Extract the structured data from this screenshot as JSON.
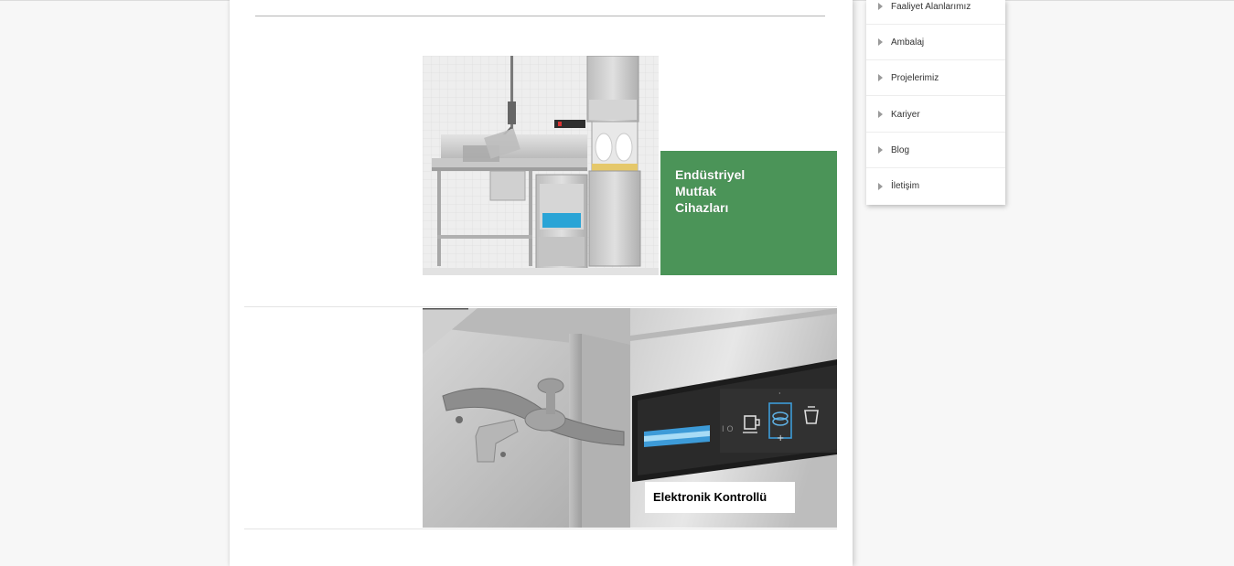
{
  "content": {
    "banner1": {
      "lines": [
        "Endüstriyel",
        "Mutfak",
        "Cihazları"
      ],
      "accent_color": "#4b9458"
    },
    "banner2": {
      "caption": "Elektronik Kontrollü",
      "panel_icons": [
        "cup-icon",
        "plates-icon",
        "pot-icon"
      ]
    }
  },
  "sidebar": {
    "items": [
      {
        "label": "Faaliyet Alanlarımız",
        "icon": "chevron-right-icon"
      },
      {
        "label": "Ambalaj",
        "icon": "chevron-right-icon"
      },
      {
        "label": "Projelerimiz",
        "icon": "chevron-right-icon"
      },
      {
        "label": "Kariyer",
        "icon": "chevron-right-icon"
      },
      {
        "label": "Blog",
        "icon": "chevron-right-icon"
      },
      {
        "label": "İletişim",
        "icon": "chevron-right-icon"
      }
    ]
  }
}
